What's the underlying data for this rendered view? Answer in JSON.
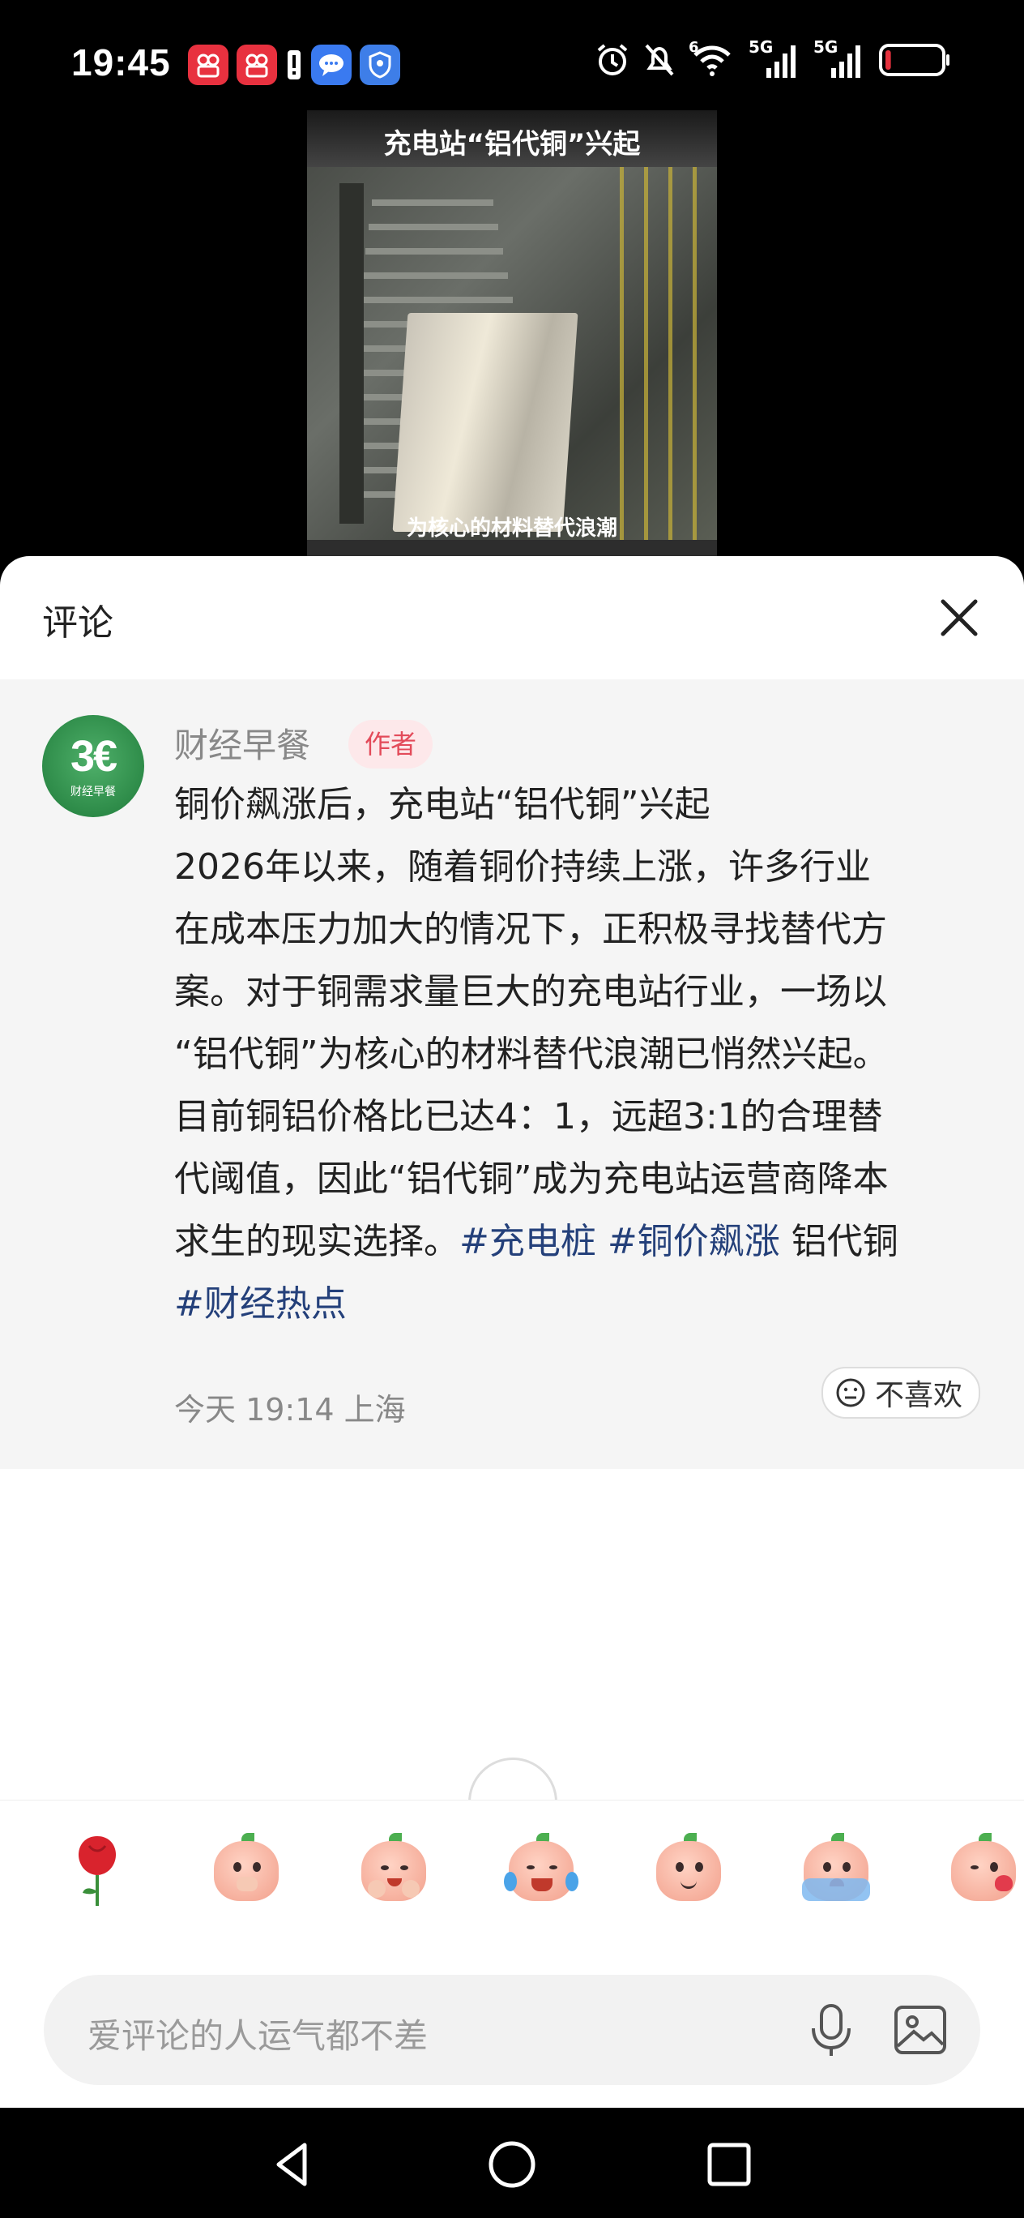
{
  "status_bar": {
    "time": "19:45",
    "app_icons": [
      "kuaishou-icon",
      "kuaishou-icon",
      "alert-icon",
      "message-icon",
      "security-icon"
    ],
    "system_icons": [
      "alarm-icon",
      "mute-icon",
      "wifi-icon",
      "signal-5g-icon",
      "signal-5g-icon",
      "battery-low-icon"
    ],
    "wifi_label": "6",
    "signal_label_1": "5G",
    "signal_label_2": "5G",
    "battery_level": 0.1
  },
  "video": {
    "title": "充电站“铝代铜”兴起",
    "subtitle": "为核心的材料替代浪潮"
  },
  "comments": {
    "title": "评论",
    "close_icon": "close-icon",
    "items": [
      {
        "author": "财经早餐",
        "badge": "作者",
        "avatar_mark": "3€",
        "avatar_sub": "财经早餐",
        "text_lines": [
          "铜价飙涨后，充电站“铝代铜”兴起",
          "2026年以来，随着铜价持续上涨，许多行业",
          "在成本压力加大的情况下，正积极寻找替代方",
          "案。对于铜需求量巨大的充电站行业，一场以",
          "“铝代铜”为核心的材料替代浪潮已悄然兴起。",
          "目前铜铝价格比已达4：1，远超3:1的合理替",
          "代阈值，因此“铝代铜”成为充电站运营商降本",
          "求生的现实选择。"
        ],
        "tags": [
          "#充电桩",
          "#铜价飙涨"
        ],
        "plain_tag": "铝代铜",
        "last_tag": "#财经热点",
        "time_location": "今天 19:14 上海",
        "dislike_label": "不喜欢"
      }
    ]
  },
  "emoji_bar": {
    "items": [
      "rose-icon",
      "covering-mouth-emoji",
      "clapping-emoji",
      "laughing-tears-emoji",
      "smiling-emoji",
      "crying-emoji",
      "kiss-emoji"
    ]
  },
  "input": {
    "placeholder": "爱评论的人运气都不差",
    "mic_icon": "mic-icon",
    "image_icon": "image-icon"
  },
  "nav": {
    "items": [
      "back-icon",
      "home-icon",
      "recents-icon"
    ]
  },
  "colors": {
    "tag_color": "#24407a",
    "badge_bg": "#fde8ea",
    "badge_text": "#e34b5a",
    "comment_bg": "#f5f5f5"
  }
}
